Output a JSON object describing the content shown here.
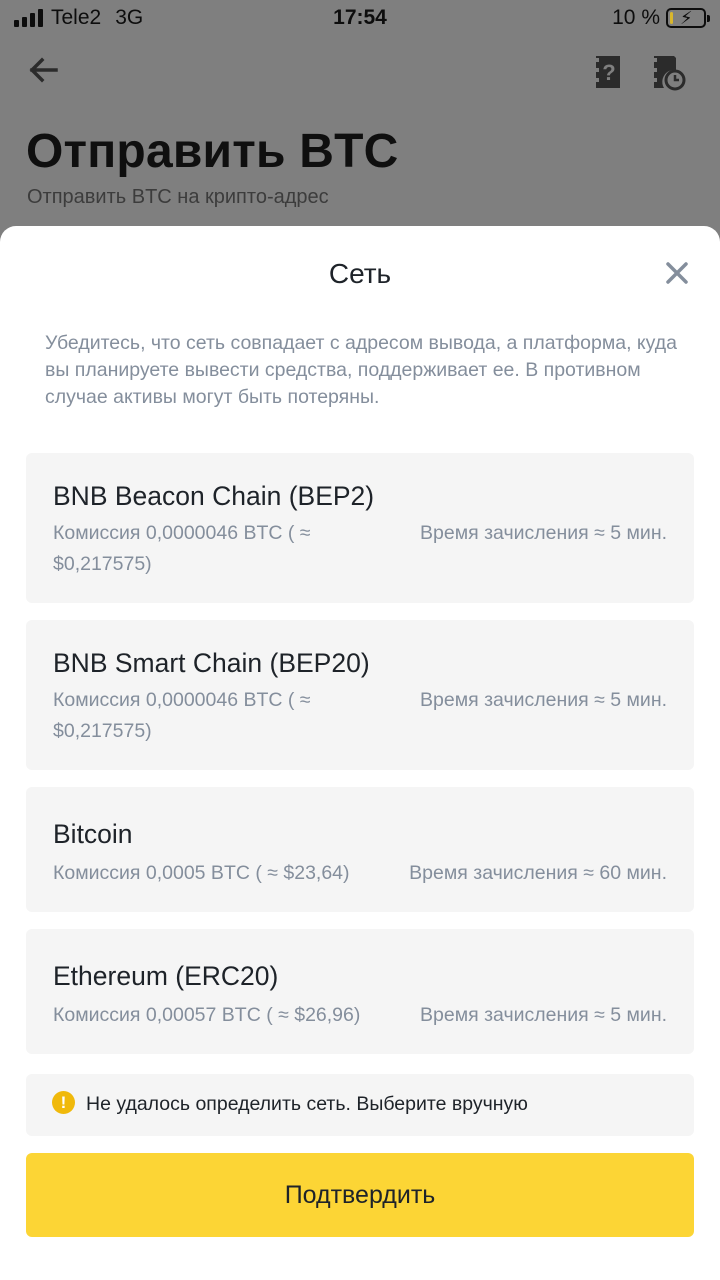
{
  "status_bar": {
    "carrier": "Tele2",
    "network": "3G",
    "time": "17:54",
    "battery": "10 %",
    "battery_level": 0.1
  },
  "background_page": {
    "title": "Отправить BTC",
    "subtitle": "Отправить BTC на крипто-адрес",
    "icons": [
      "back-arrow-icon",
      "help-document-icon",
      "history-icon"
    ]
  },
  "sheet": {
    "title": "Сеть",
    "notice": "Убедитесь, что сеть совпадает с адресом вывода, а платформа, куда вы планируете вывести средства, поддерживает ее. В противном случае активы могут быть потеряны.",
    "networks": [
      {
        "name": "BNB Beacon Chain (BEP2)",
        "fee": "Комиссия 0,0000046 BTC ( ≈ $0,217575)",
        "time": "Время зачисления ≈ 5 мин."
      },
      {
        "name": "BNB Smart Chain (BEP20)",
        "fee": "Комиссия 0,0000046 BTC ( ≈ $0,217575)",
        "time": "Время зачисления ≈ 5 мин."
      },
      {
        "name": "Bitcoin",
        "fee": "Комиссия 0,0005 BTC ( ≈ $23,64)",
        "time": "Время зачисления ≈ 60 мин."
      },
      {
        "name": "Ethereum (ERC20)",
        "fee": "Комиссия 0,00057 BTC ( ≈ $26,96)",
        "time": "Время зачисления ≈ 5 мин."
      }
    ],
    "warning": "Не удалось определить сеть. Выберите вручную",
    "confirm_label": "Подтвердить"
  },
  "colors": {
    "accent": "#fcd535",
    "warning": "#f0b90b",
    "secondary_text": "#848e9c",
    "primary_text": "#1e2329",
    "card_bg": "#f5f5f5"
  }
}
